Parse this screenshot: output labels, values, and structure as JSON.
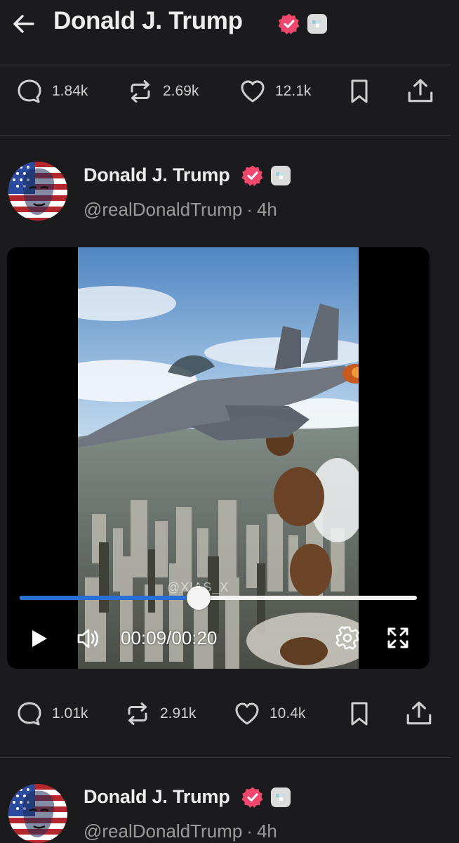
{
  "header": {
    "title": "Donald J. Trump",
    "back_icon": "arrow-left-icon"
  },
  "colors": {
    "background": "#1b1b1d",
    "verified_badge": "#f0476e",
    "progress_fill": "#2b6fd6",
    "text_primary": "#ededed",
    "text_secondary": "#9a9a9a"
  },
  "post_top_actions": {
    "replies": "1.84k",
    "reposts": "2.69k",
    "likes": "12.1k"
  },
  "video_post": {
    "author_name": "Donald J. Trump",
    "handle": "@realDonaldTrump",
    "separator": "·",
    "time_ago": "4h",
    "video": {
      "watermark": "@XIAS_X",
      "current_time": "00:09",
      "time_separator": "/",
      "duration": "00:20",
      "progress": 0.45
    },
    "actions": {
      "replies": "1.01k",
      "reposts": "2.91k",
      "likes": "10.4k"
    }
  },
  "next_post": {
    "author_name": "Donald J. Trump",
    "handle": "@realDonaldTrump",
    "separator": "·",
    "time_ago": "4h"
  }
}
